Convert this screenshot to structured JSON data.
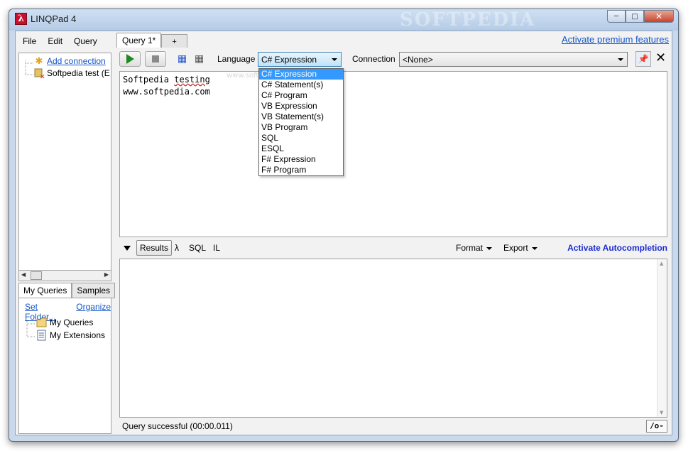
{
  "window": {
    "title": "LINQPad 4",
    "watermark": "SOFTPEDIA",
    "title_icon": "λ",
    "controls": [
      "minimize-icon",
      "maximize-icon",
      "close-icon"
    ]
  },
  "menu": [
    "File",
    "Edit",
    "Query"
  ],
  "connections": {
    "add_label": "Add connection",
    "items": [
      "Softpedia test (E"
    ]
  },
  "my_queries": {
    "tabs": [
      "My Queries",
      "Samples"
    ],
    "set_folder": "Set Folder...",
    "organize": "Organize",
    "items": [
      "My Queries",
      "My Extensions"
    ]
  },
  "query_tabs": [
    "Query 1*",
    "+"
  ],
  "premium_link": "Activate premium features",
  "toolbar": {
    "language_label": "Language",
    "language_value": "C# Expression",
    "connection_label": "Connection",
    "connection_value": "<None>"
  },
  "editor": {
    "lines": [
      "Softpedia testing",
      "www.softpedia.com"
    ],
    "faint_text": "www.softpedia.com"
  },
  "language_options": [
    "C# Expression",
    "C# Statement(s)",
    "C# Program",
    "VB Expression",
    "VB Statement(s)",
    "VB Program",
    "SQL",
    "ESQL",
    "F# Expression",
    "F# Program"
  ],
  "results_bar": {
    "results": "Results",
    "lambda": "λ",
    "sql": "SQL",
    "il": "IL",
    "format": "Format",
    "export": "Export",
    "autocomplete": "Activate Autocompletion"
  },
  "status": {
    "text": "Query successful  (00:00.011)",
    "button": "/o-"
  }
}
